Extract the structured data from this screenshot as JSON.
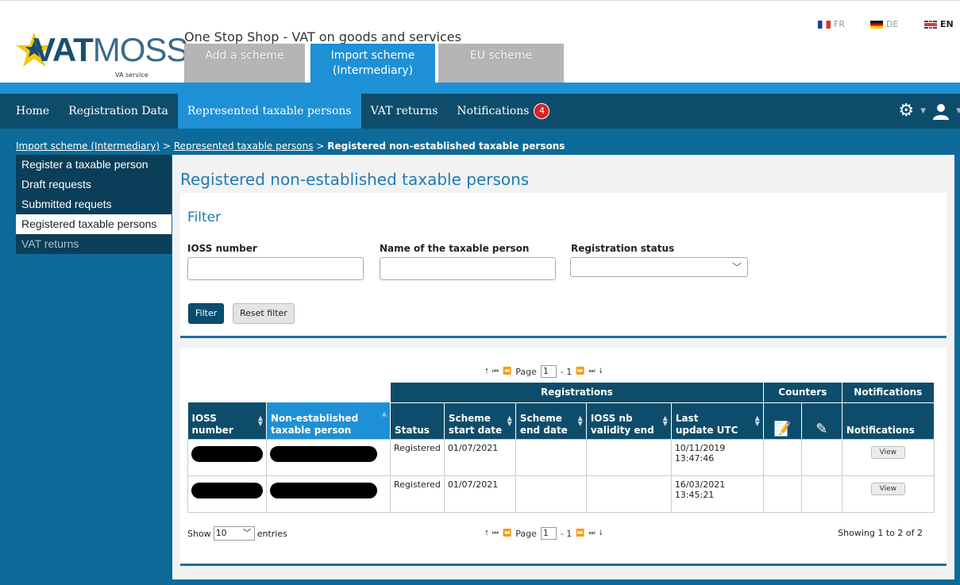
{
  "app": {
    "logo_bold": "VAT",
    "logo_light": "MOSS",
    "logo_sub_brand": "",
    "logo_sub_text": "VA service",
    "title": "One Stop Shop - VAT on goods and services"
  },
  "scheme_tabs": [
    {
      "label": "Add a scheme",
      "active": false
    },
    {
      "label": "Import scheme (Intermediary)",
      "active": true
    },
    {
      "label": "EU scheme",
      "active": false
    }
  ],
  "languages": [
    {
      "code": "FR",
      "active": false
    },
    {
      "code": "DE",
      "active": false
    },
    {
      "code": "EN",
      "active": true
    }
  ],
  "nav": {
    "items": [
      "Home",
      "Registration Data",
      "Represented taxable persons",
      "VAT returns",
      "Notifications"
    ],
    "notifications_count": "4"
  },
  "breadcrumb": {
    "part1": "Import scheme (Intermediary)",
    "part2": "Represented taxable persons",
    "current": "Registered non-established taxable persons",
    "separator": ">"
  },
  "sidebar": {
    "items": [
      "Register a taxable person",
      "Draft requests",
      "Submitted requets",
      "Registered taxable persons",
      "VAT returns"
    ]
  },
  "page": {
    "title": "Registered non-established taxable persons"
  },
  "filter": {
    "title": "Filter",
    "ioss_label": "IOSS number",
    "ioss_value": "",
    "name_label": "Name of the taxable person",
    "name_value": "",
    "status_label": "Registration status",
    "status_value": "",
    "filter_button": "Filter",
    "reset_button": "Reset filter"
  },
  "pager": {
    "page_label": "Page",
    "page_value": "1",
    "page_total": "- 1"
  },
  "table": {
    "groups": {
      "registrations": "Registrations",
      "counters": "Counters",
      "notifications": "Notifications"
    },
    "columns": {
      "ioss": "IOSS number",
      "name": "Non-established taxable person",
      "status": "Status",
      "start": "Scheme start date",
      "end": "Scheme end date",
      "validity": "IOSS nb validity end",
      "updated": "Last update UTC",
      "notifications": "Notifications"
    },
    "rows": [
      {
        "status": "Registered",
        "start": "01/07/2021",
        "end": "",
        "validity": "",
        "updated": "10/11/2019 13:47:46",
        "action": "View"
      },
      {
        "status": "Registered",
        "start": "01/07/2021",
        "end": "",
        "validity": "",
        "updated": "16/03/2021 13:45:21",
        "action": "View"
      }
    ]
  },
  "footer": {
    "show_label": "Show",
    "entries_value": "10",
    "entries_label": "entries",
    "showing_text": "Showing 1 to 2 of 2"
  },
  "colors": {
    "nav_dark": "#0d4d6b",
    "accent_blue": "#1e90d6",
    "content_bg": "#0d6a99",
    "badge_red": "#d9202a"
  }
}
